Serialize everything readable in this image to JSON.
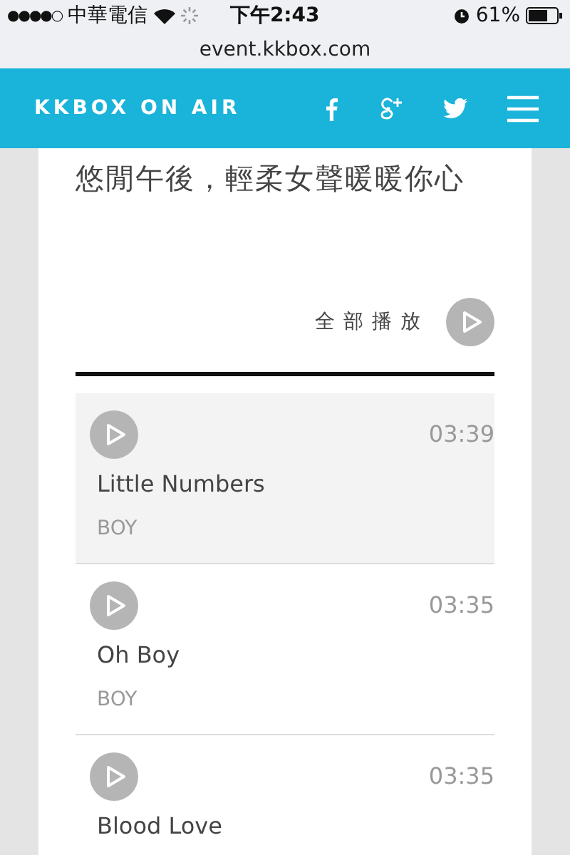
{
  "status_bar": {
    "signal_bars": "●●●●○",
    "carrier": "中華電信",
    "time": "下午2:43",
    "battery": "61%"
  },
  "url_bar": {
    "url": "event.kkbox.com"
  },
  "header": {
    "title": "KKBOX ON AIR"
  },
  "playlist": {
    "title": "悠閒午後，輕柔女聲暖暖你心",
    "play_all": "全部播放",
    "tracks": [
      {
        "title": "Little Numbers",
        "artist": "BOY",
        "duration": "03:39",
        "selected": true
      },
      {
        "title": "Oh Boy",
        "artist": "BOY",
        "duration": "03:35",
        "selected": false
      },
      {
        "title": "Blood Love",
        "duration": "03:35",
        "selected": false
      }
    ]
  }
}
